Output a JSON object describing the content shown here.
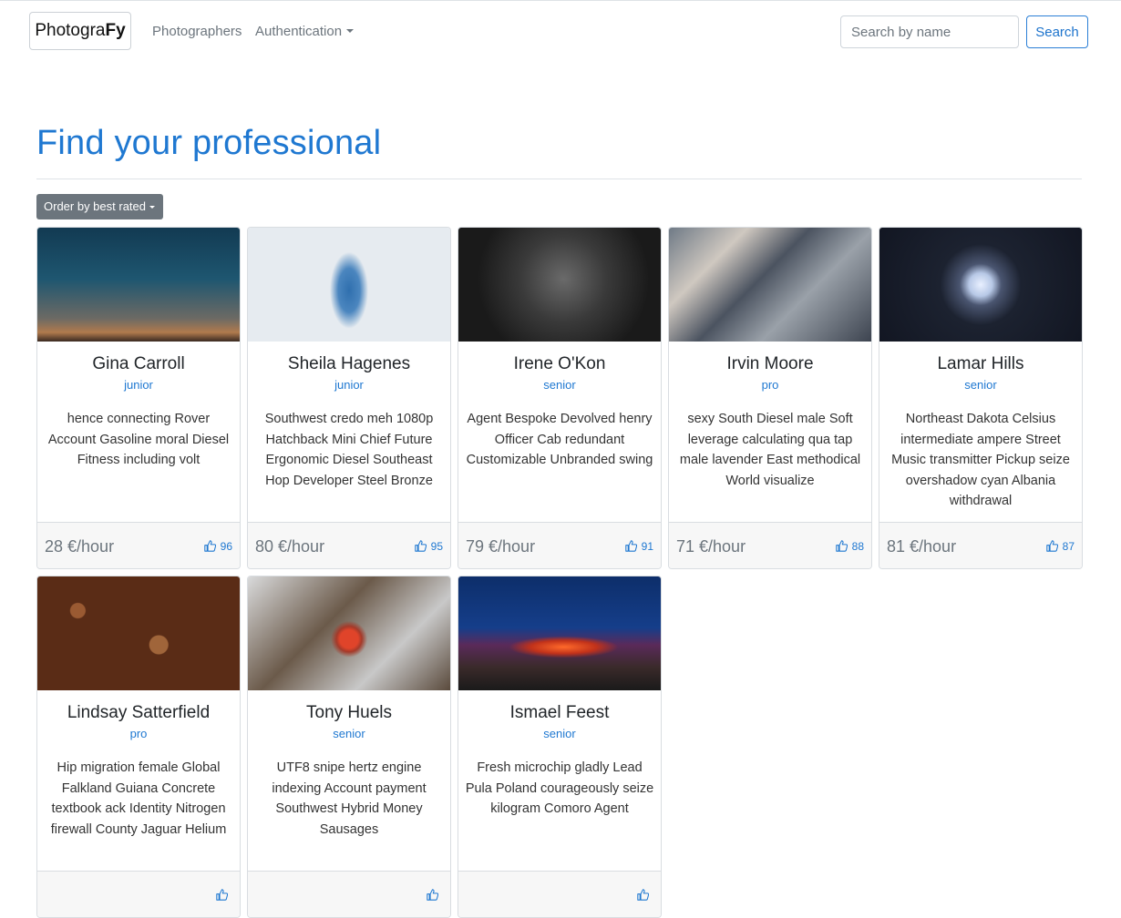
{
  "navbar": {
    "brand_prefix": "Photogra",
    "brand_suffix": "Fy",
    "links": [
      "Photographers",
      "Authentication"
    ],
    "search_placeholder": "Search by name",
    "search_button": "Search"
  },
  "page": {
    "title": "Find your professional",
    "order_button": "Order by best rated"
  },
  "photographers": [
    {
      "name": "Gina Carroll",
      "level": "junior",
      "description": "hence connecting Rover Account Gasoline moral Diesel Fitness including volt",
      "price": "28 €/hour",
      "likes": "96",
      "image": "img-sky"
    },
    {
      "name": "Sheila Hagenes",
      "level": "junior",
      "description": "Southwest credo meh 1080p Hatchback Mini Chief Future Ergonomic Diesel Southeast Hop Developer Steel Bronze",
      "price": "80 €/hour",
      "likes": "95",
      "image": "img-ink"
    },
    {
      "name": "Irene O'Kon",
      "level": "senior",
      "description": "Agent Bespoke Devolved henry Officer Cab redundant Customizable Unbranded swing",
      "price": "79 €/hour",
      "likes": "91",
      "image": "img-face"
    },
    {
      "name": "Irvin Moore",
      "level": "pro",
      "description": "sexy South Diesel male Soft leverage calculating qua tap male lavender East methodical World visualize",
      "price": "71 €/hour",
      "likes": "88",
      "image": "img-crowd"
    },
    {
      "name": "Lamar Hills",
      "level": "senior",
      "description": "Northeast Dakota Celsius intermediate ampere Street Music transmitter Pickup seize overshadow cyan Albania withdrawal",
      "price": "81 €/hour",
      "likes": "87",
      "image": "img-moon"
    },
    {
      "name": "Lindsay Satterfield",
      "level": "pro",
      "description": "Hip migration female Global Falkland Guiana Concrete textbook ack Identity Nitrogen firewall County Jaguar Helium",
      "price": "",
      "likes": "",
      "image": "img-wood"
    },
    {
      "name": "Tony Huels",
      "level": "senior",
      "description": "UTF8 snipe hertz engine indexing Account payment Southwest Hybrid Money Sausages",
      "price": "",
      "likes": "",
      "image": "img-flower"
    },
    {
      "name": "Ismael Feest",
      "level": "senior",
      "description": "Fresh microchip gladly Lead Pula Poland courageously seize kilogram Comoro Agent",
      "price": "",
      "likes": "",
      "image": "img-volcano"
    }
  ],
  "colors": {
    "accent": "#1f78d1",
    "order_button_bg": "#6c757d"
  },
  "icons": {
    "likes": "thumbs-up-icon"
  }
}
